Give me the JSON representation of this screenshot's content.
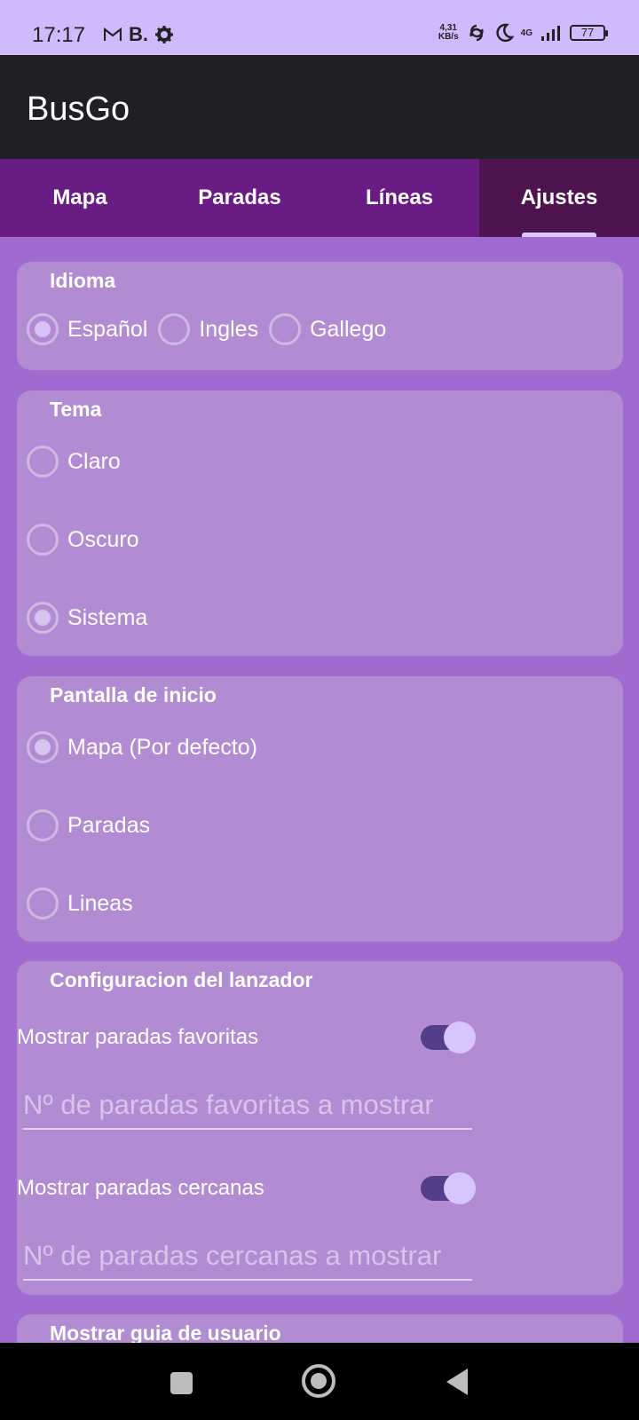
{
  "status_bar": {
    "time": "17:17",
    "notification_icons": [
      "gmail-icon",
      "b-app-icon",
      "gear-icon"
    ],
    "b_app_label": "B.",
    "net_speed_value": "4,31",
    "net_speed_unit": "KB/s",
    "network_label": "4G",
    "battery_level": "77"
  },
  "app_bar": {
    "title": "BusGo"
  },
  "tabs": [
    {
      "label": "Mapa",
      "active": false
    },
    {
      "label": "Paradas",
      "active": false
    },
    {
      "label": "Líneas",
      "active": false
    },
    {
      "label": "Ajustes",
      "active": true
    }
  ],
  "settings": {
    "language": {
      "title": "Idioma",
      "options": [
        "Español",
        "Ingles",
        "Gallego"
      ],
      "selected": "Español"
    },
    "theme": {
      "title": "Tema",
      "options": [
        "Claro",
        "Oscuro",
        "Sistema"
      ],
      "selected": "Sistema"
    },
    "start_screen": {
      "title": "Pantalla de inicio",
      "options": [
        "Mapa (Por defecto)",
        "Paradas",
        "Lineas"
      ],
      "selected": "Mapa (Por defecto)"
    },
    "launcher": {
      "title": "Configuracion del lanzador",
      "show_favorites_label": "Mostrar paradas favoritas",
      "show_favorites_on": true,
      "favorites_count_placeholder": "Nº de paradas favoritas a mostrar",
      "show_nearby_label": "Mostrar paradas cercanas",
      "show_nearby_on": true,
      "nearby_count_placeholder": "Nº de paradas cercanas a mostrar"
    },
    "user_guide": {
      "title": "Mostrar guia de usuario"
    }
  },
  "colors": {
    "status_bar_bg": "#d1b9fd",
    "app_bar_bg": "#202024",
    "tab_bar_bg": "#681c84",
    "tab_active_bg": "#4d1450",
    "page_bg": "#a06ad0",
    "card_bg": "#b28cd2",
    "toggle_track": "#543d89",
    "toggle_knob": "#d6c5ff"
  },
  "nav_bar": {
    "buttons": [
      "recents-square-icon",
      "home-circle-icon",
      "back-triangle-icon"
    ]
  }
}
